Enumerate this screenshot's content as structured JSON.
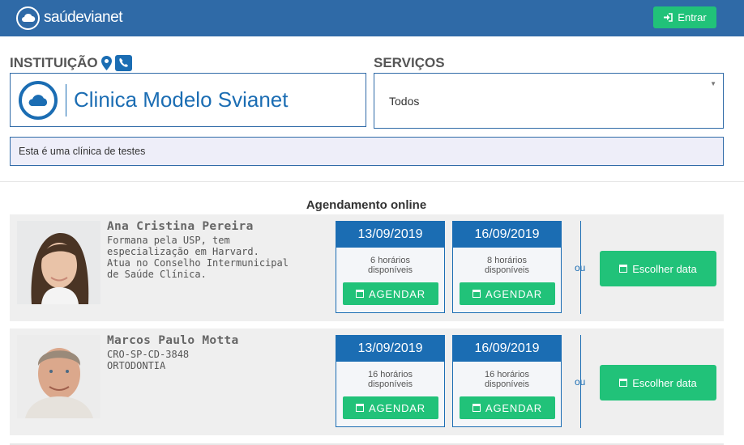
{
  "header": {
    "logo_text": "saúdevianet",
    "login_label": "Entrar"
  },
  "institution": {
    "label": "INSTITUIÇÃO",
    "name": "Clinica Modelo Svianet"
  },
  "services": {
    "label": "SERVIÇOS",
    "selected": "Todos"
  },
  "description": "Esta é uma clínica de testes",
  "agenda_title": "Agendamento online",
  "doctors": [
    {
      "name": "Ana Cristina Pereira",
      "description": "Formana pela USP, tem\nespecialização em Harvard.\nAtua no Conselho Intermunicipal\nde Saúde Clínica.",
      "slots": [
        {
          "date": "13/09/2019",
          "availability": "6 horários\ndisponíveis",
          "button": "AGENDAR"
        },
        {
          "date": "16/09/2019",
          "availability": "8 horários\ndisponíveis",
          "button": "AGENDAR"
        }
      ],
      "or": "ou",
      "choose_label": "Escolher data"
    },
    {
      "name": "Marcos Paulo Motta",
      "description": "CRO-SP-CD-3848\nORTODONTIA",
      "slots": [
        {
          "date": "13/09/2019",
          "availability": "16 horários\ndisponíveis",
          "button": "AGENDAR"
        },
        {
          "date": "16/09/2019",
          "availability": "16 horários\ndisponíveis",
          "button": "AGENDAR"
        }
      ],
      "or": "ou",
      "choose_label": "Escolher data"
    }
  ],
  "colors": {
    "header": "#2f6aa7",
    "accent_blue": "#1b6db3",
    "green": "#21c279",
    "card_bg": "#efefef"
  }
}
